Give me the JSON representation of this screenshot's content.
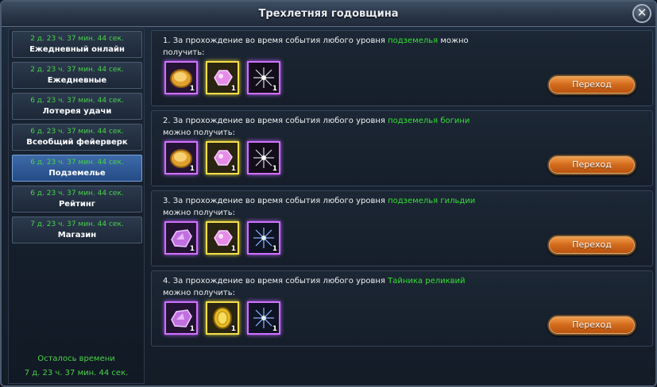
{
  "window": {
    "title": "Трехлетняя годовщина",
    "close_symbol": "✕"
  },
  "sidebar": {
    "items": [
      {
        "timer": "2 д. 23 ч. 37 мин. 44 сек.",
        "label": "Ежедневный онлайн",
        "active": false
      },
      {
        "timer": "2 д. 23 ч. 37 мин. 44 сек.",
        "label": "Ежедневные",
        "active": false
      },
      {
        "timer": "6 д. 23 ч. 37 мин. 44 сек.",
        "label": "Лотерея удачи",
        "active": false
      },
      {
        "timer": "6 д. 23 ч. 37 мин. 44 сек.",
        "label": "Всеобщий фейерверк",
        "active": false
      },
      {
        "timer": "6 д. 23 ч. 37 мин. 44 сек.",
        "label": "Подземелье",
        "active": true
      },
      {
        "timer": "6 д. 23 ч. 37 мин. 44 сек.",
        "label": "Рейтинг",
        "active": false
      },
      {
        "timer": "7 д. 23 ч. 37 мин. 44 сек.",
        "label": "Магазин",
        "active": false
      }
    ],
    "remaining_label": "Осталось времени",
    "remaining_value": "7 д. 23 ч. 37 мин. 44 сек."
  },
  "quests": [
    {
      "prefix": "1. За прохождение во время события любого уровня ",
      "highlight": "подземелья",
      "suffix": " можно получить:",
      "rewards": [
        {
          "icon": "gold-coin-icon",
          "count": "1"
        },
        {
          "icon": "pink-crystal-icon",
          "count": "1"
        },
        {
          "icon": "firework-icon",
          "count": "1"
        }
      ],
      "button": "Переход"
    },
    {
      "prefix": "2. За прохождение во время события любого уровня ",
      "highlight": "подземелья богини",
      "suffix": " можно получить:",
      "rewards": [
        {
          "icon": "gold-coin-icon",
          "count": "1"
        },
        {
          "icon": "pink-crystal-icon",
          "count": "1"
        },
        {
          "icon": "firework-icon",
          "count": "1"
        }
      ],
      "button": "Переход"
    },
    {
      "prefix": "3. За прохождение во время события любого уровня ",
      "highlight": "подземелья гильдии",
      "suffix": " можно получить:",
      "rewards": [
        {
          "icon": "purple-gem-icon",
          "count": "1"
        },
        {
          "icon": "pink-crystal-icon",
          "count": "1"
        },
        {
          "icon": "blue-firework-icon",
          "count": "1"
        }
      ],
      "button": "Переход"
    },
    {
      "prefix": "4. За прохождение во время события любого уровня ",
      "highlight": "Тайника реликвий",
      "suffix": " можно получить:",
      "rewards": [
        {
          "icon": "purple-gem-icon",
          "count": "1"
        },
        {
          "icon": "gold-medal-icon",
          "count": "1"
        },
        {
          "icon": "blue-firework-icon",
          "count": "1"
        }
      ],
      "button": "Переход"
    }
  ],
  "colors": {
    "highlight": "#35e035",
    "timer": "#49d249",
    "button": "#d26a1c",
    "slot_purple": "#d070ff",
    "slot_gold": "#f2e04a"
  }
}
